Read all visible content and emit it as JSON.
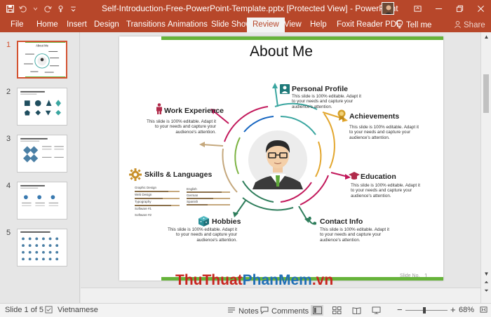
{
  "window": {
    "title": "Self-Introduction-Free-PowerPoint-Template.pptx [Protected View]  -  PowerPoint",
    "accent": "#b7472a"
  },
  "ribbon": {
    "tabs": [
      "File",
      "Home",
      "Insert",
      "Design",
      "Transitions",
      "Animations",
      "Slide Show",
      "Review",
      "View",
      "Help",
      "Foxit Reader PDF"
    ],
    "active_tab": "Review",
    "tell_me": "Tell me",
    "share": "Share"
  },
  "thumbnails": {
    "numbers": [
      "1",
      "2",
      "3",
      "4",
      "5"
    ],
    "active": "1"
  },
  "slide": {
    "title": "About Me",
    "nodes": {
      "personal_profile": {
        "title": "Personal Profile",
        "desc": "This slide is 100% editable. Adapt it to your needs and capture your audience's attention."
      },
      "achievements": {
        "title": "Achievements",
        "desc": "This slide is 100% editable. Adapt it to your needs and capture your audience's attention."
      },
      "education": {
        "title": "Education",
        "desc": "This slide is 100% editable. Adapt it to your needs and capture your audience's attention."
      },
      "contact_info": {
        "title": "Contact Info",
        "desc": "This slide is 100% editable. Adapt it to your needs and capture your audience's attention."
      },
      "hobbies": {
        "title": "Hobbies",
        "desc": "This slide is 100% editable. Adapt it to your needs and capture your audience's attention."
      },
      "skills_languages": {
        "title": "Skills & Languages"
      },
      "work_experience": {
        "title": "Work Experience",
        "desc": "This slide is 100% editable. Adapt it to your needs and capture your audience's attention."
      }
    },
    "skills_left": [
      "Graphic Design",
      "Web Design",
      "Typography",
      "Software #1",
      "Software #2"
    ],
    "skills_right": [
      "English",
      "German",
      "Spanish"
    ],
    "slide_no_label": "Slide No.",
    "slide_no": "1",
    "ring_colors": [
      "#3aa6a0",
      "#e3a72f",
      "#c2185b",
      "#2e7d5b",
      "#7cb342",
      "#1565c0"
    ]
  },
  "statusbar": {
    "slide_info": "Slide 1 of 5",
    "language": "Vietnamese",
    "notes": "Notes",
    "comments": "Comments",
    "zoom": "68%"
  },
  "watermark": {
    "part1": "ThuThuat",
    "part2": "PhanMem",
    "part3": ".vn"
  }
}
